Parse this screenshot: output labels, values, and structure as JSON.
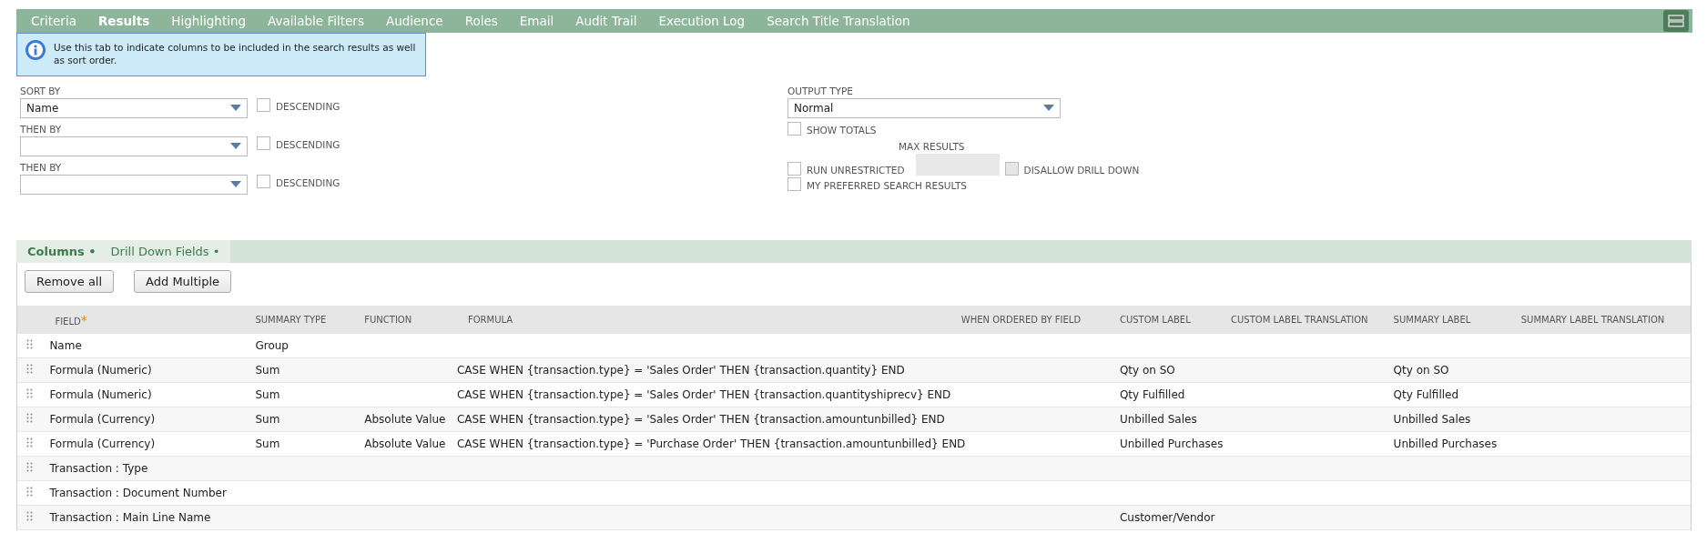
{
  "tabs": [
    {
      "label": "Criteria",
      "selected": false
    },
    {
      "label": "Results",
      "selected": true
    },
    {
      "label": "Highlighting",
      "selected": false
    },
    {
      "label": "Available Filters",
      "selected": false
    },
    {
      "label": "Audience",
      "selected": false
    },
    {
      "label": "Roles",
      "selected": false
    },
    {
      "label": "Email",
      "selected": false
    },
    {
      "label": "Audit Trail",
      "selected": false
    },
    {
      "label": "Execution Log",
      "selected": false
    },
    {
      "label": "Search Title Translation",
      "selected": false
    }
  ],
  "info": "Use this tab to indicate columns to be included in the search results as well as sort order.",
  "sort_fields": [
    {
      "label": "SORT BY",
      "value": "Name",
      "descending_label": "DESCENDING",
      "descending": false
    },
    {
      "label": "THEN BY",
      "descending_label": "DESCENDING",
      "descending": false
    },
    {
      "label": "THEN BY",
      "descending_label": "DESCENDING",
      "descending": false
    }
  ],
  "output_type": {
    "label": "OUTPUT TYPE",
    "value": "Normal"
  },
  "show_totals": {
    "label": "SHOW TOTALS",
    "checked": false
  },
  "max_results": {
    "label": "MAX RESULTS"
  },
  "run_unrestricted": {
    "label": "RUN UNRESTRICTED",
    "checked": false
  },
  "disallow_drill_down": {
    "label": "DISALLOW DRILL DOWN",
    "checked": false,
    "disabled": true
  },
  "my_preferred": {
    "label": "MY PREFERRED SEARCH RESULTS",
    "checked": false
  },
  "subtabs": [
    {
      "label": "Columns •",
      "selected": true
    },
    {
      "label": "Drill Down Fields •",
      "selected": false
    }
  ],
  "buttons": [
    "Remove all",
    "Add Multiple"
  ],
  "table": {
    "columns": [
      "FIELD",
      "SUMMARY TYPE",
      "FUNCTION",
      "FORMULA",
      "WHEN ORDERED BY FIELD",
      "CUSTOM LABEL",
      "CUSTOM LABEL TRANSLATION",
      "SUMMARY LABEL",
      "SUMMARY LABEL TRANSLATION"
    ],
    "required_mark": "*",
    "rows": [
      [
        "Name",
        "Group",
        "",
        "",
        "",
        "",
        "",
        "",
        ""
      ],
      [
        "Formula (Numeric)",
        "Sum",
        "",
        "CASE WHEN {transaction.type} = 'Sales Order' THEN {transaction.quantity} END",
        "",
        "Qty on SO",
        "",
        "Qty on SO",
        ""
      ],
      [
        "Formula (Numeric)",
        "Sum",
        "",
        "CASE WHEN {transaction.type} = 'Sales Order' THEN {transaction.quantityshiprecv} END",
        "",
        "Qty Fulfilled",
        "",
        "Qty Fulfilled",
        ""
      ],
      [
        "Formula (Currency)",
        "Sum",
        "Absolute Value",
        "CASE WHEN {transaction.type} = 'Sales Order' THEN {transaction.amountunbilled} END",
        "",
        "Unbilled Sales",
        "",
        "Unbilled Sales",
        ""
      ],
      [
        "Formula (Currency)",
        "Sum",
        "Absolute Value",
        "CASE WHEN {transaction.type} = 'Purchase Order' THEN {transaction.amountunbilled} END",
        "",
        "Unbilled Purchases",
        "",
        "Unbilled Purchases",
        ""
      ],
      [
        "Transaction : Type",
        "",
        "",
        "",
        "",
        "",
        "",
        "",
        ""
      ],
      [
        "Transaction : Document Number",
        "",
        "",
        "",
        "",
        "",
        "",
        "",
        ""
      ],
      [
        "Transaction : Main Line Name",
        "",
        "",
        "",
        "",
        "Customer/Vendor",
        "",
        "",
        ""
      ]
    ]
  }
}
